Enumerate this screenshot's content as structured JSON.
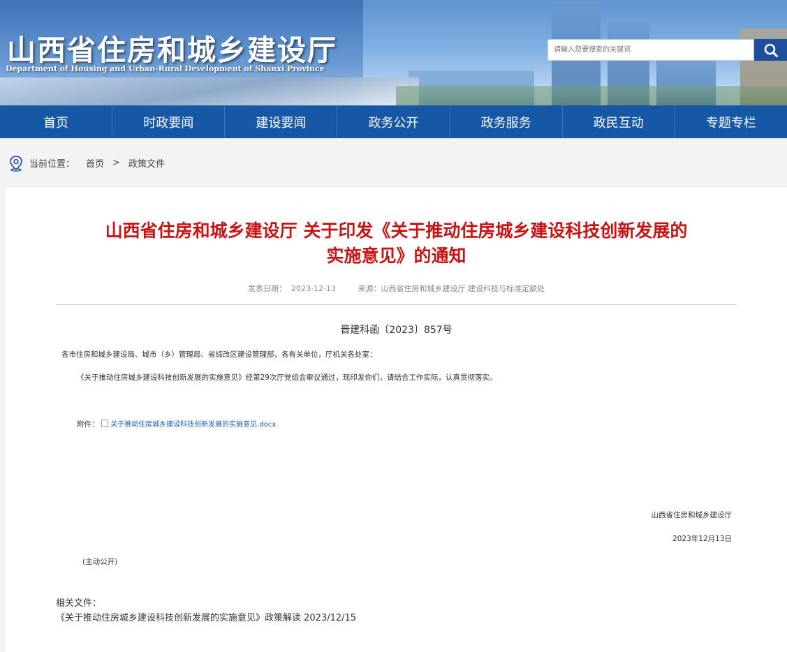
{
  "header": {
    "site_title": "山西省住房和城乡建设厅",
    "site_subtitle": "Department of Housing and Urban-Rural Development of Shanxi Province",
    "search_placeholder": "请输入您要搜索的关键词"
  },
  "nav": {
    "items": [
      "首页",
      "时政要闻",
      "建设要闻",
      "政务公开",
      "政务服务",
      "政民互动",
      "专题专栏"
    ]
  },
  "breadcrumb": {
    "label": "当前位置：",
    "home": "首页",
    "separator": ">",
    "current": "政策文件"
  },
  "article": {
    "title_line1": "山西省住房和城乡建设厅 关于印发《关于推动住房城乡建设科技创新发展的",
    "title_line2": "实施意见》的通知",
    "date_label": "发表日期：",
    "date": "2023-12-13",
    "source_label": "来源：",
    "source": "山西省住房和城乡建设厅 建设科技与标准定额处",
    "doc_number": "晋建科函〔2023〕857号",
    "addressee": "各市住房和城乡建设局、城市（乡）管理局、省综改区建设管理部，各有关单位，厅机关各处室：",
    "body": "《关于推动住房城乡建设科技创新发展的实施意见》经第29次厅党组会审议通过，现印发你们，请结合工作实际，认真贯彻落实。",
    "attachment_label": "附件：",
    "attachment_file": "关于推动住房城乡建设科技创新发展的实施意见.docx",
    "signature_org": "山西省住房和城乡建设厅",
    "signature_date": "2023年12月13日",
    "disclosure": "(主动公开)"
  },
  "related": {
    "label": "相关文件：",
    "item": "《关于推动住房城乡建设科技创新发展的实施意见》政策解读 2023/12/15"
  },
  "colors": {
    "nav_bg": "#1657a6",
    "title_red": "#c81414",
    "search_btn": "#1e4f9c",
    "link_blue": "#1a5fb4"
  }
}
